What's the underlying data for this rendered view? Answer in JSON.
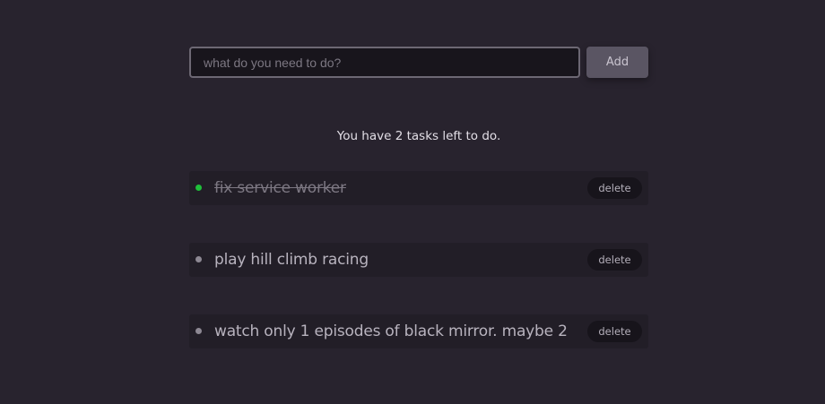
{
  "form": {
    "input_value": "",
    "input_placeholder": "what do you need to do?",
    "add_label": "Add"
  },
  "counter_text": "You have 2 tasks left to do.",
  "tasks": [
    {
      "text": "fix service worker",
      "done": true,
      "delete_label": "delete"
    },
    {
      "text": "play hill climb racing",
      "done": false,
      "delete_label": "delete"
    },
    {
      "text": "watch only 1 episodes of black mirror. maybe 2",
      "done": false,
      "delete_label": "delete"
    }
  ],
  "colors": {
    "background": "#28232e",
    "done_dot": "#1fbf3a",
    "pending_dot": "#8d8893"
  }
}
